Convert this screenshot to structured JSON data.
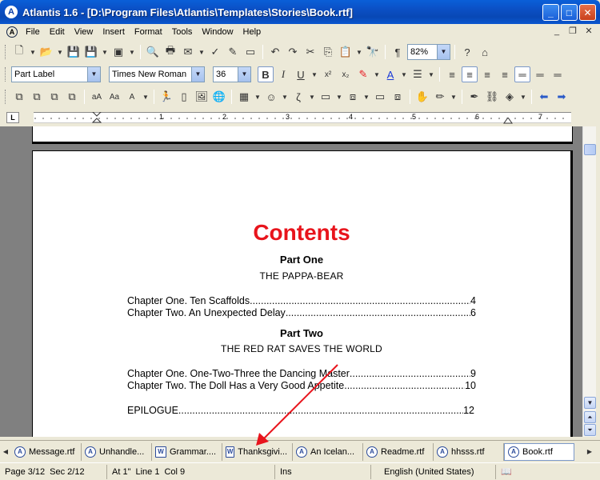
{
  "window": {
    "title": "Atlantis 1.6 - [D:\\Program Files\\Atlantis\\Templates\\Stories\\Book.rtf]"
  },
  "menu": [
    "File",
    "Edit",
    "View",
    "Insert",
    "Format",
    "Tools",
    "Window",
    "Help"
  ],
  "toolbar": {
    "zoom": "82%",
    "style": "Part Label",
    "font": "Times New Roman",
    "size": "36"
  },
  "ruler": {
    "numbers": [
      "1",
      "2",
      "3",
      "4",
      "5",
      "6",
      "7"
    ]
  },
  "document": {
    "title": "Contents",
    "part_one": "Part One",
    "part_one_sub": "THE PAPPA-BEAR",
    "part_two": "Part Two",
    "part_two_sub": "THE RED RAT SAVES THE WORLD",
    "toc": [
      {
        "text": "Chapter One. Ten Scaffolds",
        "page": "4"
      },
      {
        "text": "Chapter Two. An Unexpected Delay",
        "page": "6"
      },
      {
        "text": "Chapter One. One-Two-Three the Dancing Master",
        "page": "9"
      },
      {
        "text": "Chapter Two. The Doll Has a Very Good Appetite",
        "page": "10"
      },
      {
        "text": "EPILOGUE",
        "page": "12"
      }
    ]
  },
  "doc_tabs": [
    "Message.rtf",
    "Unhandle...",
    "Grammar....",
    "Thanksgivi...",
    "An Icelan...",
    "Readme.rtf",
    "hhsss.rtf",
    "Book.rtf"
  ],
  "status": {
    "page": "Page 3/12",
    "sec": "Sec 2/12",
    "pos": "At 1\"",
    "line": "Line 1",
    "col": "Col 9",
    "ins": "Ins",
    "lang": "English (United States)"
  },
  "colors": {
    "accent_red": "#e8141c",
    "titlebar_blue": "#0b4fc4"
  }
}
